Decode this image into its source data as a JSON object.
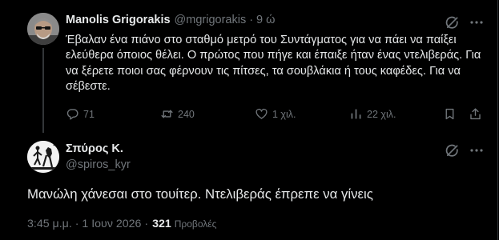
{
  "tweet": {
    "author_name": "Manolis Grigorakis",
    "author_handle": "@mgrigorakis",
    "separator": "·",
    "time": "9 ώ",
    "text": "Έβαλαν ένα πιάνο στο σταθμό μετρό του Συντάγματος για να πάει να παίξει ελεύθερα όποιος θέλει. Ο πρώτος που πήγε και έπαιξε ήταν ένας ντελιβεράς. Για να ξέρετε ποιοι σας φέρνουν τις πίτσες, τα σουβλάκια ή τους καφέδες. Για να σέβεστε.",
    "replies": "71",
    "retweets": "240",
    "likes": "1 χιλ.",
    "views": "22 χιλ."
  },
  "reply": {
    "author_name": "Σπύρος Κ.",
    "author_handle": "@spiros_kyr",
    "text": "Μανώλη χάνεσαι στο τουίτερ. Ντελιβεράς έπρεπε να γίνεις",
    "timestamp": "3:45 μ.μ. · 1 Ιουν 2026 ·",
    "views_count": "321",
    "views_label": "Προβολές"
  },
  "icons": [
    "grok-icon",
    "more-icon",
    "reply-icon",
    "retweet-icon",
    "like-icon",
    "views-icon",
    "bookmark-icon",
    "share-icon"
  ],
  "colors": {
    "background": "#000000",
    "text": "#e7e9ea",
    "muted": "#71767b",
    "border": "#2f3336"
  }
}
